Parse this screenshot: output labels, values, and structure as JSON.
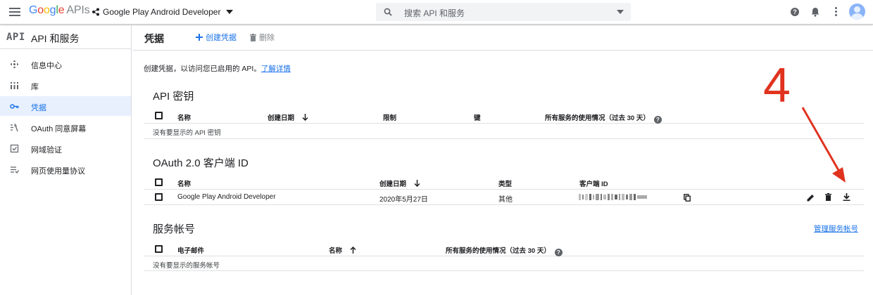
{
  "topbar": {
    "logo_google": "Google",
    "logo_apis": "APIs",
    "project": "Google Play Android Developer",
    "search_placeholder": "搜索 API 和服务"
  },
  "sidebar": {
    "badge": "API",
    "title": "API 和服务",
    "items": [
      {
        "label": "信息中心",
        "icon": "dashboard-icon"
      },
      {
        "label": "库",
        "icon": "library-icon"
      },
      {
        "label": "凭据",
        "icon": "key-icon",
        "active": true
      },
      {
        "label": "OAuth 同意屏幕",
        "icon": "consent-icon"
      },
      {
        "label": "网域验证",
        "icon": "domain-check-icon"
      },
      {
        "label": "网页使用量协议",
        "icon": "agreement-icon"
      }
    ]
  },
  "header": {
    "title": "凭据",
    "create_label": "创建凭据",
    "delete_label": "删除"
  },
  "intro": {
    "text": "创建凭据，以访问您已启用的 API。",
    "link": "了解详情"
  },
  "api_keys": {
    "title": "API 密钥",
    "columns": [
      "名称",
      "创建日期",
      "限制",
      "键",
      "所有服务的使用情况（过去 30 天）"
    ],
    "empty": "没有要显示的 API 密钥"
  },
  "oauth": {
    "title": "OAuth 2.0 客户端 ID",
    "columns": [
      "名称",
      "创建日期",
      "类型",
      "客户端 ID"
    ],
    "rows": [
      {
        "name": "Google Play Android Developer",
        "date": "2020年5月27日",
        "type": "其他"
      }
    ]
  },
  "service_accounts": {
    "title": "服务帐号",
    "manage_link": "管理服务帐号",
    "columns": [
      "电子邮件",
      "名称",
      "所有服务的使用情况（过去 30 天）"
    ],
    "empty": "没有要显示的服务帐号"
  },
  "annotation": {
    "number": "4",
    "color": "#e0331f"
  },
  "colors": {
    "accent": "#1a73e8",
    "active_bg": "#e8f0fe"
  }
}
